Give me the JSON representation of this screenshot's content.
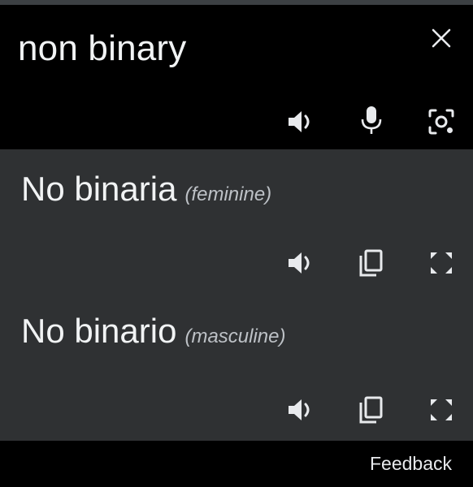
{
  "source": {
    "text": "non binary",
    "icons": [
      "close-icon",
      "speaker-icon",
      "microphone-icon",
      "camera-lens-icon"
    ]
  },
  "results": [
    {
      "text": "No binaria",
      "gender": "(feminine)",
      "icons": [
        "speaker-icon",
        "copy-icon",
        "fullscreen-icon"
      ]
    },
    {
      "text": "No binario",
      "gender": "(masculine)",
      "icons": [
        "speaker-icon",
        "copy-icon",
        "fullscreen-icon"
      ]
    }
  ],
  "footer": {
    "feedback": "Feedback"
  },
  "colors": {
    "background": "#000000",
    "result_panel": "#2f3133",
    "text": "#e8eaed"
  }
}
